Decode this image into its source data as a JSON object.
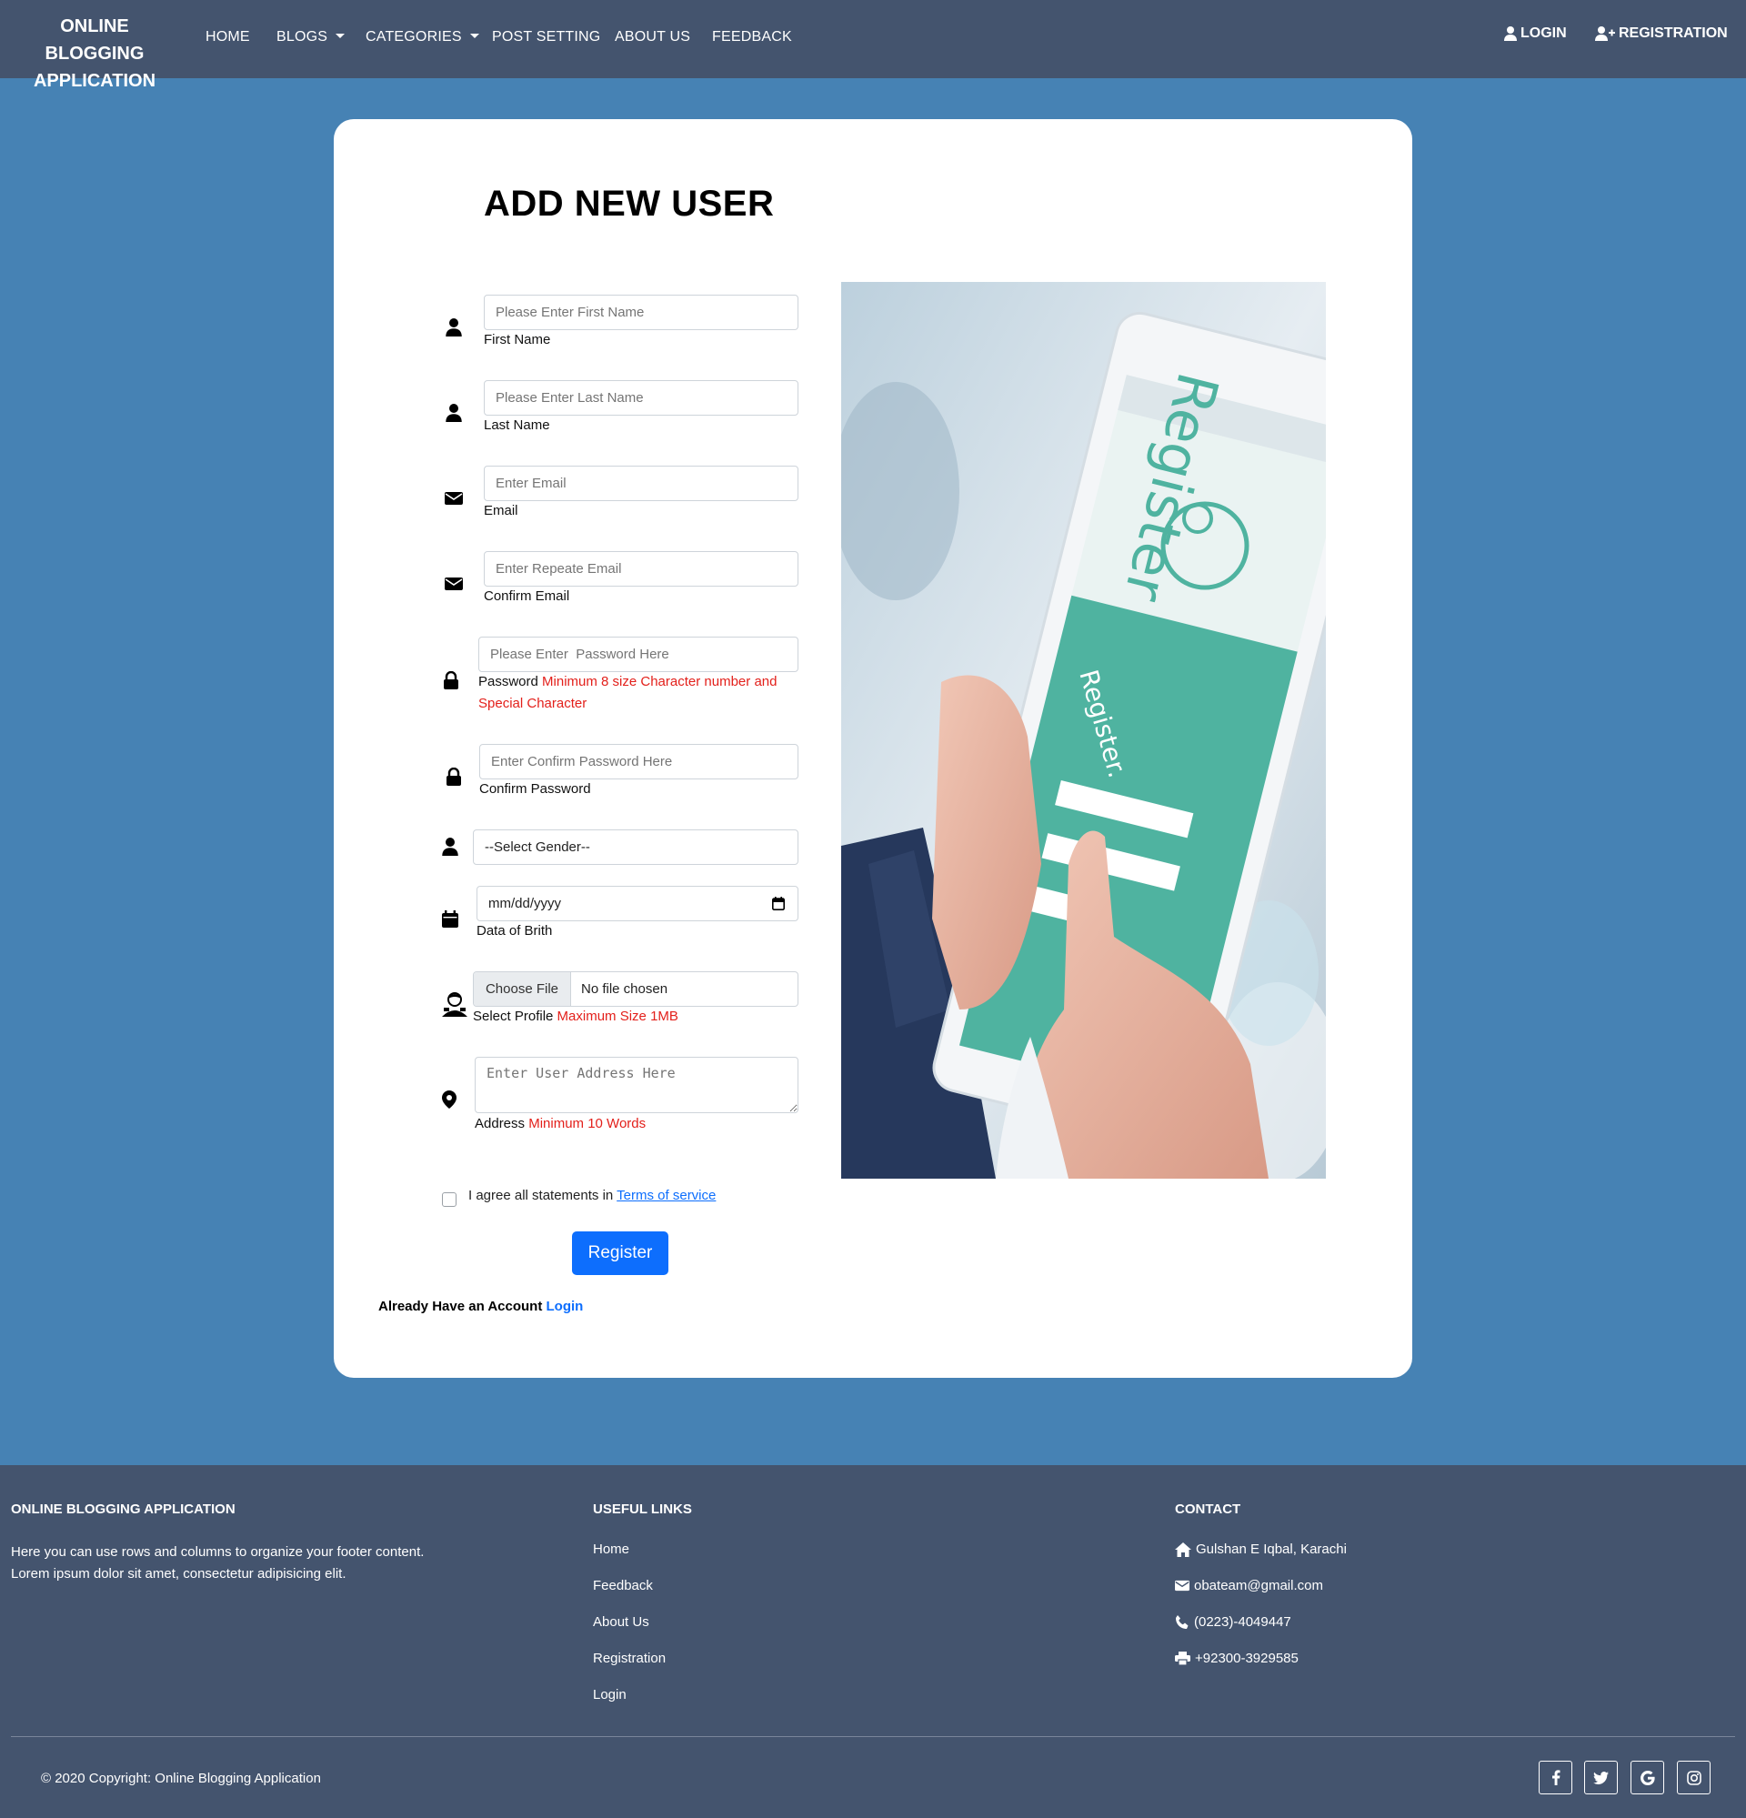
{
  "navbar": {
    "brand": "ONLINE BLOGGING APPLICATION",
    "items": [
      "HOME",
      "BLOGS",
      "CATEGORIES",
      "POST SETTING",
      "ABOUT US",
      "FEEDBACK"
    ],
    "login": "LOGIN",
    "registration": "REGISTRATION"
  },
  "form": {
    "title": "ADD NEW USER",
    "first_name": {
      "placeholder": "Please Enter First Name",
      "label": "First Name"
    },
    "last_name": {
      "placeholder": "Please Enter Last Name",
      "label": "Last Name"
    },
    "email": {
      "placeholder": "Enter Email",
      "label": "Email"
    },
    "confirm_email": {
      "placeholder": "Enter Repeate Email",
      "label": "Confirm Email"
    },
    "password": {
      "placeholder": "Please Enter  Password Here",
      "label": "Password",
      "hint_line1": "Minimum 8 size Character number and",
      "hint_line2": "Special Character"
    },
    "confirm_password": {
      "placeholder": "Enter Confirm Password Here",
      "label": "Confirm Password"
    },
    "gender": {
      "selected": "--Select Gender--"
    },
    "dob": {
      "value": "mm/dd/yyyy",
      "label": "Data of Brith"
    },
    "profile": {
      "button": "Choose File",
      "status": "No file chosen",
      "label": "Select Profile",
      "hint": "Maximum Size 1MB"
    },
    "address": {
      "placeholder": "Enter User Address Here",
      "label": "Address",
      "hint": "Minimum 10 Words"
    },
    "agree_text": "I agree all statements in",
    "terms_link": "Terms of service",
    "register_button": "Register",
    "already_text": "Already Have an Account",
    "login_link": "Login"
  },
  "promo_image": {
    "text": "Register",
    "sub_text": "Register."
  },
  "colors": {
    "navbar": "#44546e",
    "page": "#4682b4",
    "accent": "#0d6efd",
    "hint": "#e3201b",
    "promo_teal": "#4fb3a0"
  },
  "footer": {
    "about_heading": "ONLINE BLOGGING APPLICATION",
    "about_text": "Here you can use rows and columns to organize your footer content. Lorem ipsum dolor sit amet, consectetur adipisicing elit.",
    "links_heading": "USEFUL LINKS",
    "links": [
      "Home",
      "Feedback",
      "About Us",
      "Registration",
      "Login"
    ],
    "contact_heading": "CONTACT",
    "contact": {
      "address": "Gulshan E Iqbal, Karachi",
      "email": "obateam@gmail.com",
      "phone": "(0223)-4049447",
      "fax": "+92300-3929585"
    },
    "copyright": "© 2020 Copyright: Online Blogging Application",
    "social": [
      "facebook-icon",
      "twitter-icon",
      "google-icon",
      "instagram-icon"
    ]
  }
}
